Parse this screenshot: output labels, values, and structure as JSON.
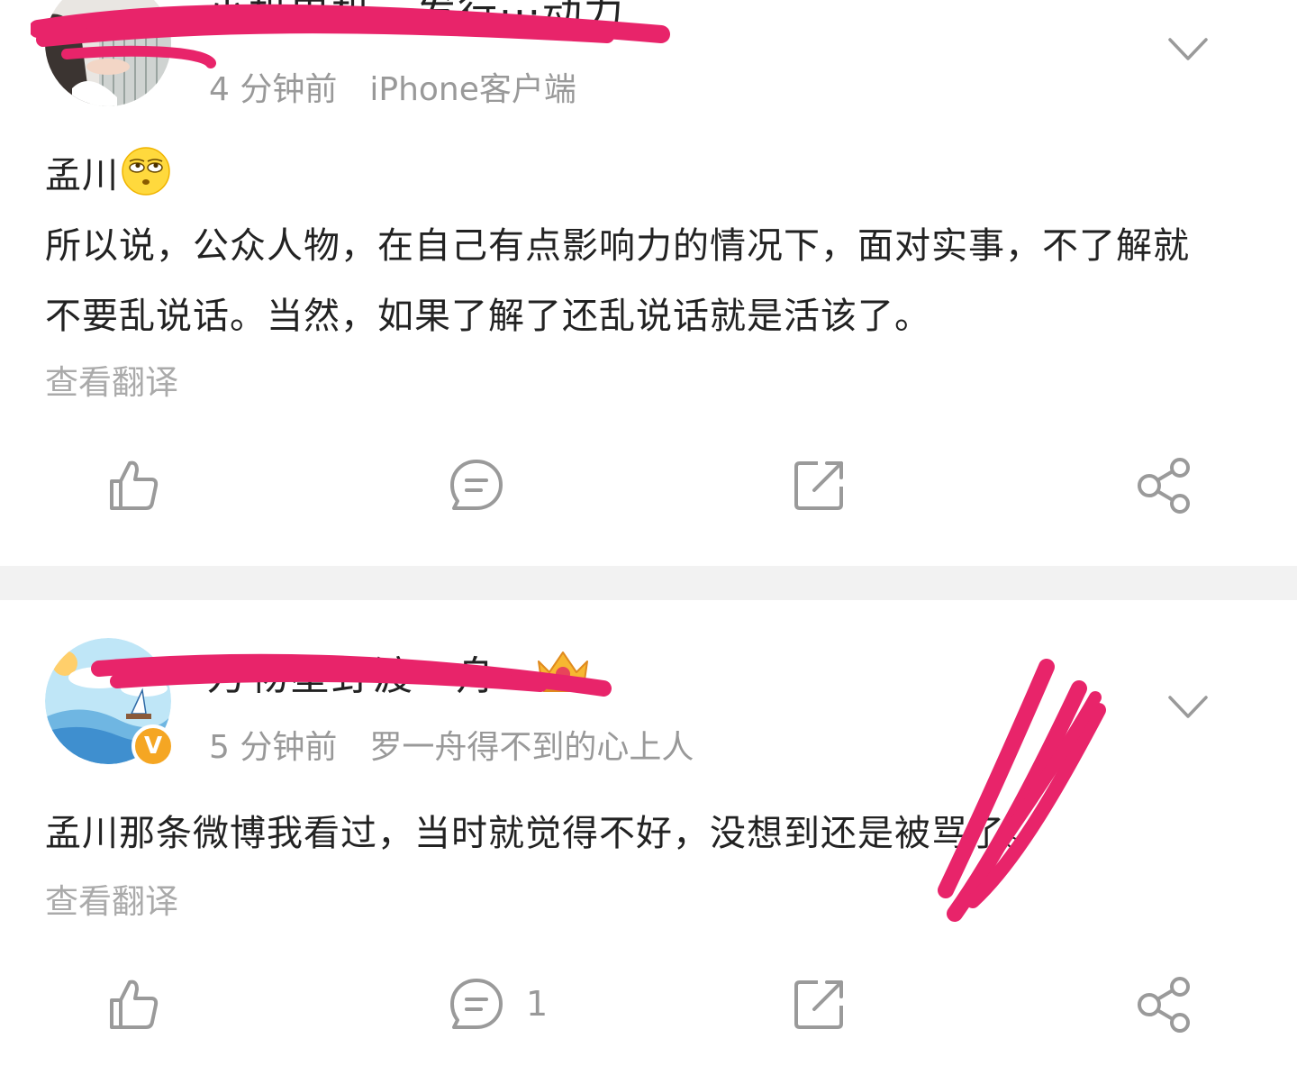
{
  "posts": [
    {
      "username": "小机电机···发行···动力",
      "time": "4 分钟前",
      "source": "iPhone客户端",
      "mention": "孟川",
      "emoji": "rolling-eyes-emoji",
      "body_lines": [
        "所以说，公众人物，在自己有点影响力的情况下，面对实事，不了解就",
        "不要乱说话。当然，如果了解了还乱说话就是活该了。"
      ],
      "translate": "查看翻译",
      "actions": {
        "like_count": "",
        "comment_count": "",
        "repost_count": ""
      }
    },
    {
      "username": "万物星野渡一舟",
      "time": "5 分钟前",
      "source": "罗一舟得不到的心上人",
      "body": "孟川那条微博我看过，当时就觉得不好，没想到还是被骂了。",
      "translate": "查看翻译",
      "verified_badge": "V",
      "actions": {
        "like_count": "",
        "comment_count": "1",
        "repost_count": ""
      }
    }
  ],
  "colors": {
    "scribble": "#e8246a",
    "meta": "#999999",
    "icon": "#9a9a9a",
    "verified": "#f5a623",
    "divider": "#f2f2f2"
  },
  "icons": {
    "more": "chevron-down-icon",
    "like": "thumbs-up-icon",
    "comment": "comment-bubble-icon",
    "repost": "repost-icon",
    "share": "share-icon",
    "fan_badge": "crown-icon"
  }
}
